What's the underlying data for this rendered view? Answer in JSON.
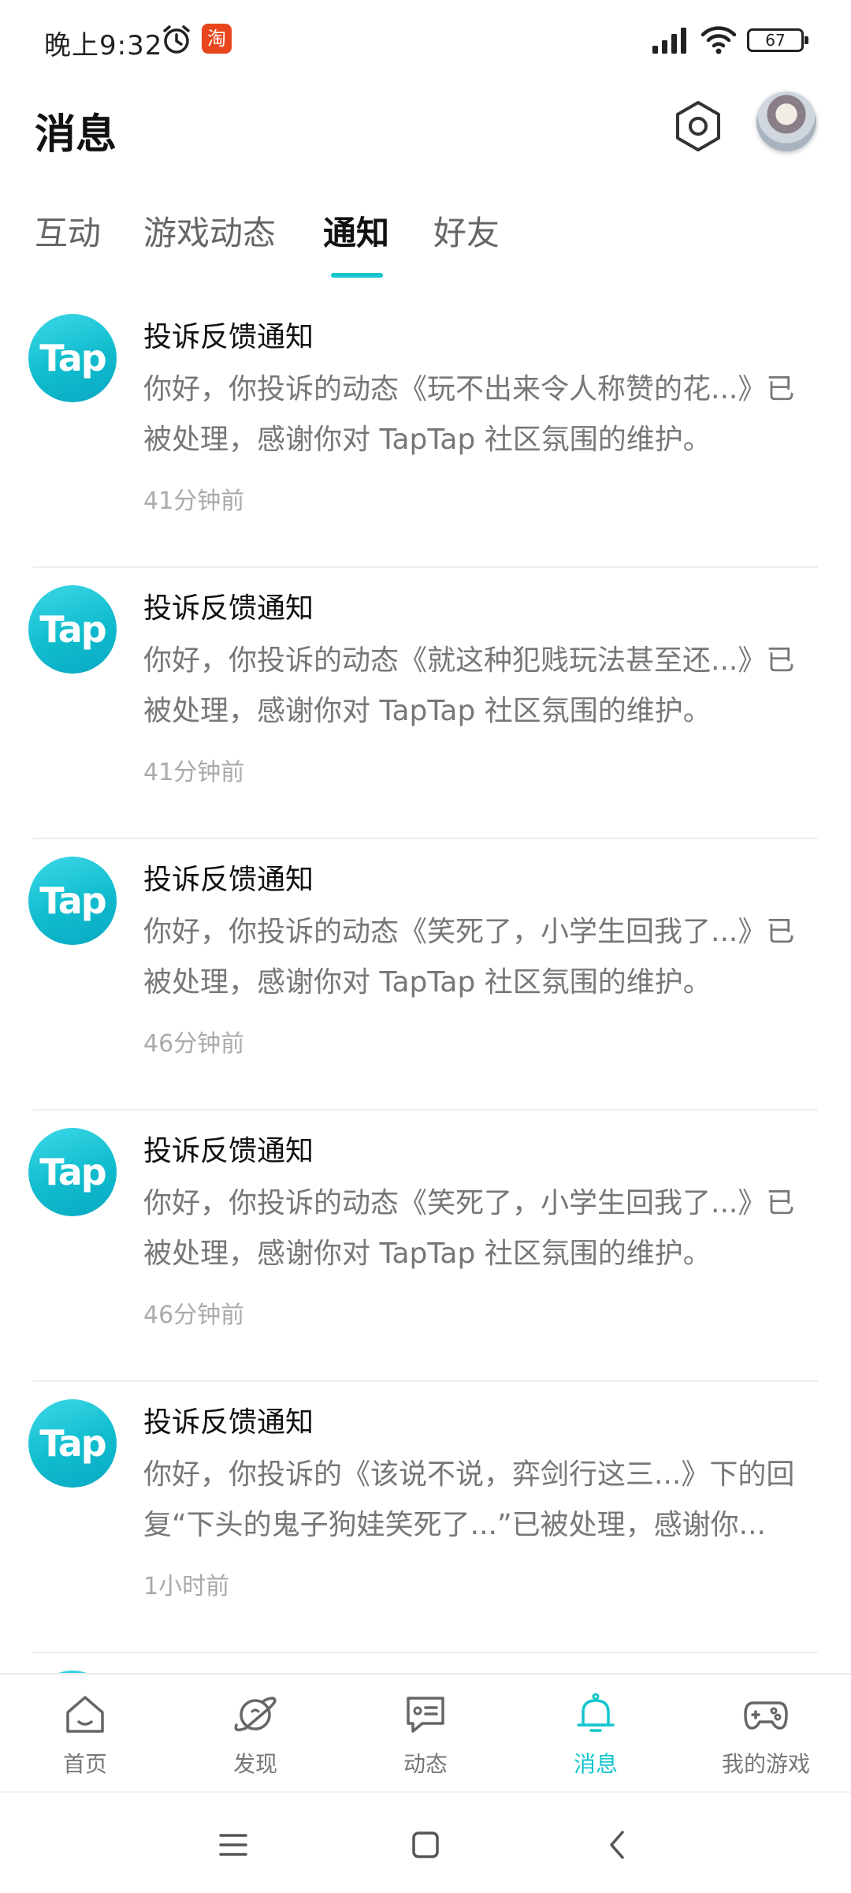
{
  "status_bar": {
    "time": "晚上9:32",
    "taobao_badge": "淘",
    "battery": "67"
  },
  "header": {
    "title": "消息"
  },
  "tabs": [
    {
      "label": "互动",
      "active": false
    },
    {
      "label": "游戏动态",
      "active": false
    },
    {
      "label": "通知",
      "active": true
    },
    {
      "label": "好友",
      "active": false
    }
  ],
  "notifications": [
    {
      "logo_text": "Tap",
      "title": "投诉反馈通知",
      "body": "你好，你投诉的动态《玩不出来令人称赞的花...》已被处理，感谢你对 TapTap 社区氛围的维护。",
      "time": "41分钟前"
    },
    {
      "logo_text": "Tap",
      "title": "投诉反馈通知",
      "body": "你好，你投诉的动态《就这种犯贱玩法甚至还...》已被处理，感谢你对 TapTap 社区氛围的维护。",
      "time": "41分钟前"
    },
    {
      "logo_text": "Tap",
      "title": "投诉反馈通知",
      "body": "你好，你投诉的动态《笑死了，小学生回我了...》已被处理，感谢你对 TapTap 社区氛围的维护。",
      "time": "46分钟前"
    },
    {
      "logo_text": "Tap",
      "title": "投诉反馈通知",
      "body": "你好，你投诉的动态《笑死了，小学生回我了...》已被处理，感谢你对 TapTap 社区氛围的维护。",
      "time": "46分钟前"
    },
    {
      "logo_text": "Tap",
      "title": "投诉反馈通知",
      "body": "你好，你投诉的《该说不说，弈剑行这三...》下的回复“下头的鬼子狗娃笑死了...”已被处理，感谢你...",
      "time": "1小时前"
    }
  ],
  "bottom_nav": [
    {
      "label": "首页",
      "icon": "home-icon",
      "active": false
    },
    {
      "label": "发现",
      "icon": "planet-icon",
      "active": false
    },
    {
      "label": "动态",
      "icon": "chat-icon",
      "active": false
    },
    {
      "label": "消息",
      "icon": "bell-icon",
      "active": true
    },
    {
      "label": "我的游戏",
      "icon": "gamepad-icon",
      "active": false
    }
  ],
  "colors": {
    "accent": "#15c5ce",
    "text_primary": "#111111",
    "text_secondary": "#777777",
    "text_tertiary": "#aaaaaa"
  }
}
